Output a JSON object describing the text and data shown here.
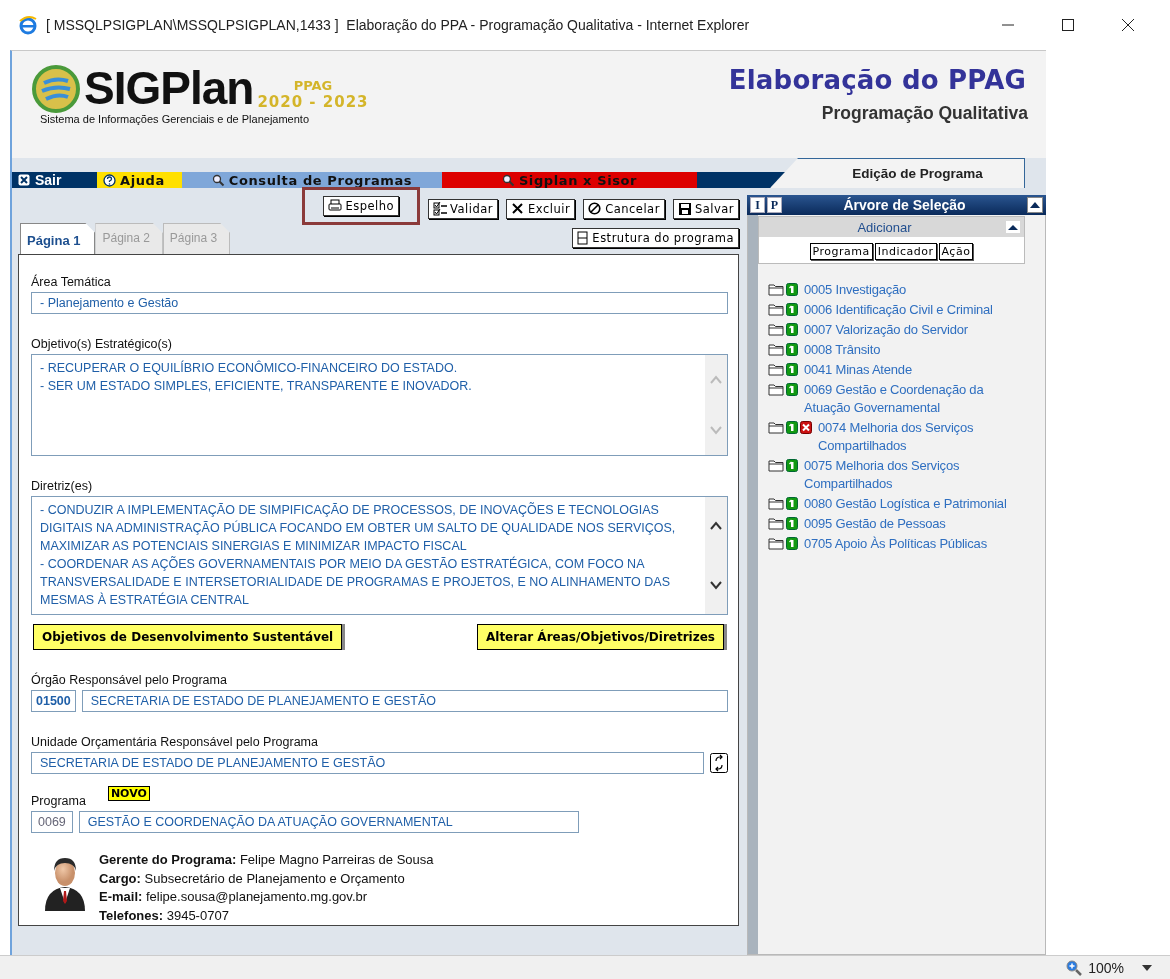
{
  "window": {
    "title": "[ MSSQLPSIGPLAN\\MSSQLPSIGPLAN,1433 ]  Elaboração do PPA - Programação Qualitativa - Internet Explorer"
  },
  "header": {
    "logo_text": "SIGPlan",
    "logo_tag": "PPAG",
    "logo_years": "2020 - 2023",
    "logo_subtitle": "Sistema de Informações Gerenciais e de Planejamento",
    "title": "Elaboração do PPAG",
    "subtitle": "Programação Qualitativa"
  },
  "nav": [
    {
      "label": "Sair",
      "color": "#003366",
      "kind": "exit"
    },
    {
      "label": "Ajuda",
      "color": "#ffe000",
      "kind": "help"
    },
    {
      "label": "Consulta de Programas",
      "color": "#7fa7d9",
      "kind": "search"
    },
    {
      "label": "Sigplan x Sisor",
      "color": "#dd0000",
      "kind": "search"
    }
  ],
  "section_tab": "Edição de Programa",
  "toolbar": [
    {
      "label": "Espelho",
      "kind": "print",
      "highlighted": true
    },
    {
      "label": "Validar",
      "kind": "check",
      "highlighted": false
    },
    {
      "label": "Excluir",
      "kind": "delete",
      "highlighted": false
    },
    {
      "label": "Cancelar",
      "kind": "cancel",
      "highlighted": false
    },
    {
      "label": "Salvar",
      "kind": "save",
      "highlighted": false
    }
  ],
  "structure_button": "Estrutura do programa",
  "tabs": [
    {
      "label": "Página 1",
      "selected": true
    },
    {
      "label": "Página 2",
      "selected": false
    },
    {
      "label": "Página 3",
      "selected": false
    }
  ],
  "form": {
    "area_label": "Área Temática",
    "area_value": "- Planejamento e Gestão",
    "objetivos_label": "Objetivo(s) Estratégico(s)",
    "objetivos": [
      "- RECUPERAR O EQUILÍBRIO ECONÔMICO-FINANCEIRO DO ESTADO.",
      "- SER UM ESTADO SIMPLES, EFICIENTE, TRANSPARENTE E INOVADOR."
    ],
    "diretrizes_label": "Diretriz(es)",
    "diretrizes": [
      "- CONDUZIR A IMPLEMENTAÇÃO DE SIMPIFICAÇÃO DE PROCESSOS, DE  INOVAÇÕES E TECNOLOGIAS DIGITAIS  NA ADMINISTRAÇÃO PÚBLICA FOCANDO EM OBTER UM SALTO DE QUALIDADE NOS SERVIÇOS, MAXIMIZAR AS POTENCIAIS SINERGIAS E MINIMIZAR IMPACTO FISCAL",
      "- COORDENAR AS AÇÕES GOVERNAMENTAIS POR MEIO DA  GESTÃO ESTRATÉGICA, COM FOCO NA TRANSVERSALIDADE E INTERSETORIALIDADE DE PROGRAMAS E PROJETOS,  E NO ALINHAMENTO DAS MESMAS À ESTRATÉGIA CENTRAL"
    ],
    "ods_button": "Objetivos de Desenvolvimento Sustentável",
    "alter_button": "Alterar Áreas/Objetivos/Diretrizes",
    "orgao_label": "Órgão Responsável pelo Programa",
    "orgao_code": "01500",
    "orgao_name": "SECRETARIA DE ESTADO DE PLANEJAMENTO E GESTÃO",
    "unidade_label": "Unidade Orçamentária Responsável pelo Programa",
    "unidade_name": "SECRETARIA DE ESTADO DE PLANEJAMENTO E GESTÃO",
    "programa_label": "Programa",
    "programa_badge": "NOVO",
    "programa_code": "0069",
    "programa_name": "GESTÃO E COORDENAÇÃO DA ATUAÇÃO GOVERNAMENTAL",
    "manager": [
      {
        "label": "Gerente do Programa:",
        "value": "Felipe Magno Parreiras de Sousa"
      },
      {
        "label": "Cargo:",
        "value": "Subsecretário de Planejamento e Orçamento"
      },
      {
        "label": "E-mail:",
        "value": "felipe.sousa@planejamento.mg.gov.br"
      },
      {
        "label": "Telefones:",
        "value": "3945-0707"
      }
    ]
  },
  "tree_panel": {
    "mode_buttons": [
      "I",
      "P"
    ],
    "title": "Árvore de Seleção",
    "add_title": "Adicionar",
    "add_buttons": [
      "Programa",
      "Indicador",
      "Ação"
    ],
    "items": [
      {
        "label": "0005 Investigação",
        "invalid": false
      },
      {
        "label": "0006 Identificação Civil e Criminal",
        "invalid": false
      },
      {
        "label": "0007 Valorização do Servidor",
        "invalid": false
      },
      {
        "label": "0008 Trânsito",
        "invalid": false
      },
      {
        "label": "0041 Minas Atende",
        "invalid": false
      },
      {
        "label": "0069 Gestão e Coordenação da Atuação Governamental",
        "invalid": false
      },
      {
        "label": "0074 Melhoria dos Serviços Compartilhados",
        "invalid": true
      },
      {
        "label": "0075 Melhoria dos Serviços Compartilhados",
        "invalid": false
      },
      {
        "label": "0080 Gestão Logística e Patrimonial",
        "invalid": false
      },
      {
        "label": "0095 Gestão de Pessoas",
        "invalid": false
      },
      {
        "label": "0705 Apoio Às Políticas Públicas",
        "invalid": false
      }
    ]
  },
  "status_bar": {
    "zoom": "100%"
  }
}
